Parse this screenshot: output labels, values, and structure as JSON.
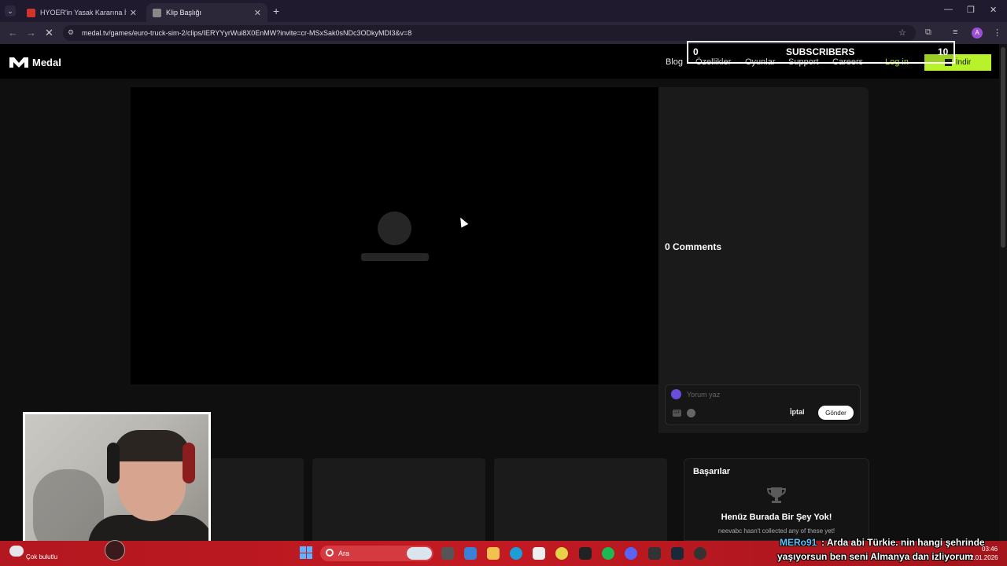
{
  "browser": {
    "tabs": [
      {
        "title": "HYOER'in Yasak Kararına İtirazı",
        "active": false
      },
      {
        "title": "Klip Başlığı",
        "active": true
      }
    ],
    "url": "medal.tv/games/euro-truck-sim-2/clips/IERYYyrWui8X0EnMW?invite=cr-MSxSak0sNDc3ODkyMDI3&v=8",
    "profile_initial": "A"
  },
  "site": {
    "brand": "Medal",
    "nav": [
      "Blog",
      "Özellikler",
      "Oyunlar",
      "Support",
      "Careers",
      "Log in"
    ],
    "download_label": "İndir",
    "accent_color": "#b8f22a"
  },
  "overlay": {
    "left_value": "0",
    "title": "SUBSCRIBERS",
    "right_value": "10"
  },
  "comments": {
    "count_label": "0 Comments",
    "input_placeholder": "Yorum yaz",
    "cancel_label": "İptal",
    "send_label": "Gönder"
  },
  "achievements": {
    "title": "Başarılar",
    "empty_title": "Henüz Burada Bir Şey Yok!",
    "empty_desc": "neevabc hasn't collected any of these yet!"
  },
  "taskbar": {
    "weather": "Çok bulutlu",
    "search_placeholder": "Ara",
    "time": "03:46",
    "date": "2.01.2026"
  },
  "stream_chat": {
    "user": "MERo91",
    "line1": ": Arda abi Türkie. nin hangi şehrinde",
    "line2": "yaşıyorsun ben seni Almanya dan izliyorum"
  }
}
